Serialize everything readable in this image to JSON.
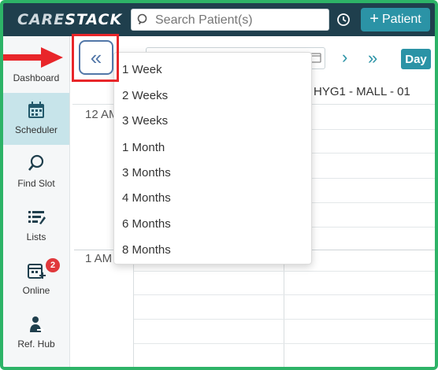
{
  "topbar": {
    "logo_part1": "CARE",
    "logo_part2": "STACK",
    "search_placeholder": "Search Patient(s)",
    "patient_button": "Patient"
  },
  "sidebar": {
    "items": [
      {
        "label": "Dashboard",
        "icon": "dashboard-icon"
      },
      {
        "label": "Scheduler",
        "icon": "calendar-icon",
        "active": true
      },
      {
        "label": "Find Slot",
        "icon": "search-icon"
      },
      {
        "label": "Lists",
        "icon": "list-icon"
      },
      {
        "label": "Online",
        "icon": "calendar-plus-icon",
        "badge": "2"
      },
      {
        "label": "Ref. Hub",
        "icon": "person-share-icon"
      }
    ]
  },
  "toolbar": {
    "collapse_icon": "«",
    "next_icon": "›",
    "fast_forward_icon": "»",
    "view_button": "Day"
  },
  "scheduler": {
    "provider_header": "HYG1 - MALL - 01",
    "time_labels": [
      "12 AM",
      "1 AM"
    ]
  },
  "range_menu": {
    "options": [
      "1 Week",
      "2 Weeks",
      "3 Weeks",
      "1 Month",
      "3 Months",
      "4 Months",
      "6 Months",
      "8 Months"
    ]
  },
  "colors": {
    "topbar": "#1f3f4d",
    "accent": "#2b93a6",
    "highlight": "#e8262a",
    "frame": "#2db367",
    "badge": "#e0383c"
  }
}
